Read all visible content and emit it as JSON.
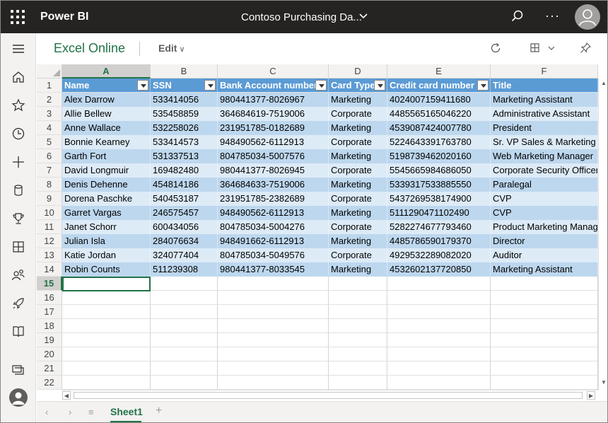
{
  "topbar": {
    "app_name": "Power BI",
    "report_title": "Contoso Purchasing Da...",
    "more_label": "···"
  },
  "leftnav": {
    "icons": [
      "menu-icon",
      "home-icon",
      "favorites-icon",
      "recent-icon",
      "create-icon",
      "datasets-icon",
      "goals-icon",
      "apps-icon",
      "shared-with-me-icon",
      "deployment-pipelines-icon",
      "learn-icon",
      "workspaces-icon",
      "account-icon"
    ]
  },
  "command_bar": {
    "title": "Excel Online",
    "edit_label": "Edit",
    "edit_chevron": "∨"
  },
  "sheet": {
    "columns": [
      "A",
      "B",
      "C",
      "D",
      "E",
      "F"
    ],
    "rows": [
      "1",
      "2",
      "3",
      "4",
      "5",
      "6",
      "7",
      "8",
      "9",
      "10",
      "11",
      "12",
      "13",
      "14",
      "15",
      "16",
      "17",
      "18",
      "19",
      "20",
      "21",
      "22"
    ],
    "active_column": "A",
    "active_row": "15",
    "table_headers": [
      "Name",
      "SSN",
      "Bank Account number",
      "Card Type",
      "Credit card number",
      "Title"
    ],
    "table_rows": [
      [
        "Alex Darrow",
        "533414056",
        "980441377-8026967",
        "Marketing",
        "4024007159411680",
        "Marketing Assistant"
      ],
      [
        "Allie Bellew",
        "535458859",
        "364684619-7519006",
        "Corporate",
        "4485565165046220",
        "Administrative Assistant"
      ],
      [
        "Anne Wallace",
        "532258026",
        "231951785-0182689",
        "Marketing",
        "4539087424007780",
        "President"
      ],
      [
        "Bonnie Kearney",
        "533414573",
        "948490562-6112913",
        "Corporate",
        "5224643391763780",
        "Sr. VP Sales & Marketing"
      ],
      [
        "Garth Fort",
        "531337513",
        "804785034-5007576",
        "Marketing",
        "5198739462020160",
        "Web Marketing Manager"
      ],
      [
        "David Longmuir",
        "169482480",
        "980441377-8026945",
        "Corporate",
        "5545665984686050",
        "Corporate Security Officer"
      ],
      [
        "Denis Dehenne",
        "454814186",
        "364684633-7519006",
        "Marketing",
        "5339317533885550",
        "Paralegal"
      ],
      [
        "Dorena Paschke",
        "540453187",
        "231951785-2382689",
        "Corporate",
        "5437269538174900",
        "CVP"
      ],
      [
        "Garret Vargas",
        "246575457",
        "948490562-6112913",
        "Marketing",
        "5111290471102490",
        "CVP"
      ],
      [
        "Janet Schorr",
        "600434056",
        "804785034-5004276",
        "Corporate",
        "5282274677793460",
        "Product Marketing Manager"
      ],
      [
        "Julian Isla",
        "284076634",
        "948491662-6112913",
        "Marketing",
        "4485786590179370",
        "Director"
      ],
      [
        "Katie Jordan",
        "324077404",
        "804785034-5049576",
        "Corporate",
        "4929532289082020",
        "Auditor"
      ],
      [
        "Robin Counts",
        "511239308",
        "980441377-8033545",
        "Marketing",
        "4532602137720850",
        "Marketing Assistant"
      ]
    ]
  },
  "sheet_tabs": {
    "prev": "‹",
    "next": "›",
    "all_sheets": "≡",
    "active_tab": "Sheet1",
    "add": "+"
  },
  "colors": {
    "topbar": "#252423",
    "excel_green": "#217346",
    "table_header": "#5b9bd5",
    "band_dark": "#bdd7ee",
    "band_light": "#ddebf7"
  }
}
